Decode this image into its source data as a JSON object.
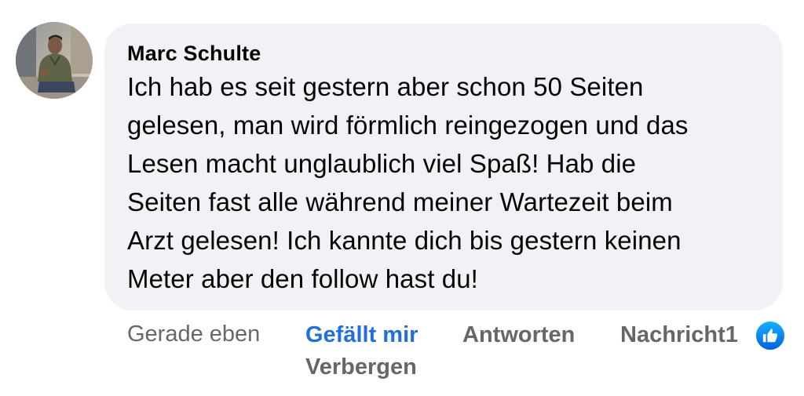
{
  "comment": {
    "author": "Marc Schulte",
    "lines": [
      "Ich hab es seit gestern aber schon 50 Seiten",
      "gelesen, man wird förmlich reingezogen und das",
      "Lesen macht unglaublich viel Spaß! Hab die",
      "Seiten fast alle während meiner Wartezeit beim",
      "Arzt gelesen! Ich kannte dich bis gestern keinen",
      "Meter aber den follow hast du!"
    ]
  },
  "actions": {
    "timestamp": "Gerade eben",
    "like_label": "Gefällt mir",
    "reply_label": "Antworten",
    "message_label": "Nachricht",
    "reaction_count": "1",
    "hide_label": "Verbergen"
  },
  "icons": {
    "reaction": "thumbs-up-icon",
    "avatar": "profile-photo"
  },
  "colors": {
    "bubble": "#f0f2f5",
    "text": "#050505",
    "muted": "#65676b",
    "like_active": "#216fdb",
    "reaction_blue": "#1877f2"
  }
}
